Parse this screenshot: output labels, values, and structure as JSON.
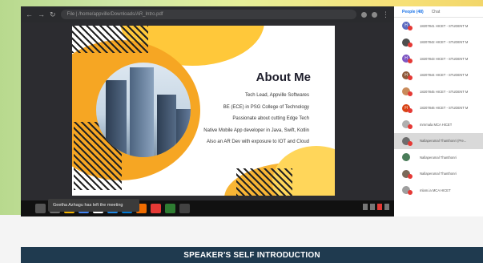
{
  "browser": {
    "url": "File | /home/appville/Downloads/AR_Intro.pdf"
  },
  "slide": {
    "title": "About Me",
    "points": [
      "Tech Lead, Appville Softwares",
      "BE (ECE) in PSG College of Technology",
      "Passionate about cutting Edge Tech",
      "Native Mobile App developer in Java, Swift, Kotlin",
      "Also an AR Dev with exposure to IOT and Cloud"
    ]
  },
  "notification": {
    "text": "Geetha Azhagu has left the meeting"
  },
  "meet_panel": {
    "people_tab": "People (48)",
    "chat_tab": "Chat",
    "participants": [
      {
        "initial": "H",
        "name": "18207841 HICET - STUDENT M",
        "color": "#5c6bc0"
      },
      {
        "initial": "",
        "name": "18207842 HICET - STUDENT M",
        "color": "#4e4e4e"
      },
      {
        "initial": "H",
        "name": "18207843 HICET - STUDENT M",
        "color": "#7e57c2"
      },
      {
        "initial": "H",
        "name": "18207844 HICET - STUDENT M",
        "color": "#8d5a3b"
      },
      {
        "initial": "",
        "name": "18207845 HICET - STUDENT M",
        "color": "#c98b5b"
      },
      {
        "initial": "H",
        "name": "18207846 HICET - STUDENT M",
        "color": "#d84315"
      },
      {
        "initial": "",
        "name": "mrnmala MCA HICET",
        "color": "#b0b0b0"
      },
      {
        "initial": "",
        "name": "Nallaperumal Thanthonri (Pre...",
        "color": "#6d6d6d"
      },
      {
        "initial": "",
        "name": "Nallaperumal Thanthonri",
        "color": "#4a7c59"
      },
      {
        "initial": "",
        "name": "Nallaperumal Thanthonri",
        "color": "#7a6a5a"
      },
      {
        "initial": "",
        "name": "mlam.ia MCA HICET",
        "color": "#9e9e9e"
      }
    ]
  },
  "footer": {
    "section_title": "SPEAKER'S SELF INTRODUCTION"
  },
  "colors": {
    "accent_orange": "#f6a623",
    "accent_yellow": "#ffc83a",
    "section_bar": "#1f3a4f",
    "meet_blue": "#1a73e8"
  }
}
